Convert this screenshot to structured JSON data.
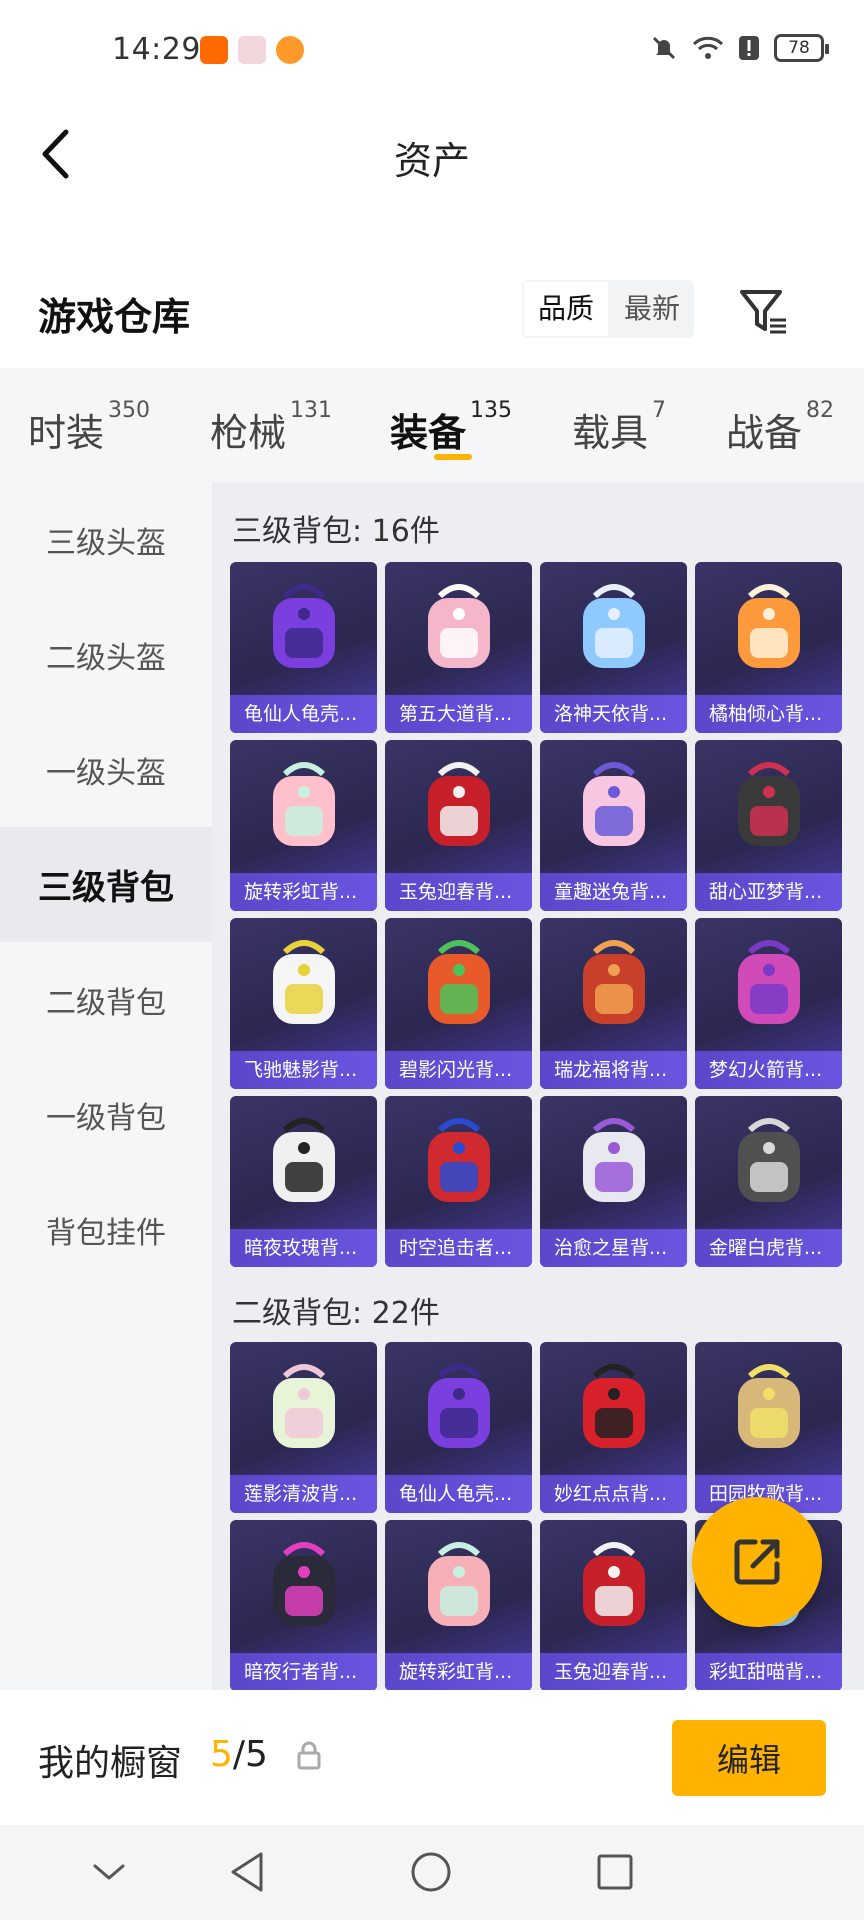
{
  "status_bar": {
    "time": "14:29",
    "battery": "78",
    "icons": [
      "taobao-app-icon",
      "app-icon-2",
      "app-icon-3",
      "mute-icon",
      "wifi-icon",
      "alert-icon"
    ]
  },
  "header": {
    "title": "资产"
  },
  "warehouse": {
    "title": "游戏仓库",
    "sort_options": [
      "品质",
      "最新"
    ],
    "active_sort": "品质"
  },
  "tabs": [
    {
      "label": "时装",
      "count": "350"
    },
    {
      "label": "枪械",
      "count": "131"
    },
    {
      "label": "装备",
      "count": "135"
    },
    {
      "label": "载具",
      "count": "7"
    },
    {
      "label": "战备",
      "count": "82"
    }
  ],
  "active_tab": "装备",
  "sidebar": {
    "items": [
      "三级头盔",
      "二级头盔",
      "一级头盔",
      "三级背包",
      "二级背包",
      "一级背包",
      "背包挂件"
    ],
    "active": "三级背包"
  },
  "sections": [
    {
      "title": "三级背包: 16件",
      "items": [
        {
          "name": "龟仙人龟壳...",
          "colors": [
            "#7b3fe0",
            "#3d2a8a"
          ]
        },
        {
          "name": "第五大道背...",
          "colors": [
            "#f4b6c8",
            "#ffffff"
          ]
        },
        {
          "name": "洛神天依背...",
          "colors": [
            "#8ec9ff",
            "#e8f0ff"
          ]
        },
        {
          "name": "橘柚倾心背...",
          "colors": [
            "#ff9a3c",
            "#fff1d6"
          ]
        },
        {
          "name": "旋转彩虹背...",
          "colors": [
            "#ffc0cb",
            "#c7f0e0"
          ]
        },
        {
          "name": "玉兔迎春背...",
          "colors": [
            "#c8202a",
            "#f2f2f2"
          ]
        },
        {
          "name": "童趣迷兔背...",
          "colors": [
            "#f8c6e0",
            "#6a5ad8"
          ]
        },
        {
          "name": "甜心亚梦背...",
          "colors": [
            "#3a3a3a",
            "#d03050"
          ]
        },
        {
          "name": "飞驰魅影背...",
          "colors": [
            "#f5f5f5",
            "#e8d23a"
          ]
        },
        {
          "name": "碧影闪光背...",
          "colors": [
            "#e85a2a",
            "#4ec25a"
          ]
        },
        {
          "name": "瑞龙福将背...",
          "colors": [
            "#c8402a",
            "#f0a050"
          ]
        },
        {
          "name": "梦幻火箭背...",
          "colors": [
            "#d04ab8",
            "#7a3ac8"
          ]
        },
        {
          "name": "暗夜玫瑰背...",
          "colors": [
            "#f0f0f0",
            "#222222"
          ]
        },
        {
          "name": "时空追击者...",
          "colors": [
            "#d02a30",
            "#2a4ad0"
          ]
        },
        {
          "name": "治愈之星背...",
          "colors": [
            "#e8e8f0",
            "#9a5ad8"
          ]
        },
        {
          "name": "金曜白虎背...",
          "colors": [
            "#505050",
            "#d8d8d8"
          ]
        }
      ]
    },
    {
      "title": "二级背包: 22件",
      "items": [
        {
          "name": "莲影清波背...",
          "colors": [
            "#e8f4d8",
            "#f0c8d8"
          ]
        },
        {
          "name": "龟仙人龟壳...",
          "colors": [
            "#7b3fe0",
            "#3d2a8a"
          ]
        },
        {
          "name": "妙红点点背...",
          "colors": [
            "#d8202a",
            "#222222"
          ]
        },
        {
          "name": "田园牧歌背...",
          "colors": [
            "#d8b878",
            "#f0e068"
          ]
        },
        {
          "name": "暗夜行者背...",
          "colors": [
            "#2a2a3a",
            "#e040c0"
          ]
        },
        {
          "name": "旋转彩虹背...",
          "colors": [
            "#f8b0b8",
            "#c8f0e0"
          ]
        },
        {
          "name": "玉兔迎春背...",
          "colors": [
            "#c8202a",
            "#f2f2f2"
          ]
        },
        {
          "name": "彩虹甜喵背...",
          "colors": [
            "#a8e0f8",
            "#f8c8e0"
          ]
        }
      ]
    }
  ],
  "showcase": {
    "label": "我的橱窗",
    "current": "5",
    "separator": "/",
    "total": "5",
    "edit_label": "编辑"
  },
  "theme": {
    "accent": "#ffb300",
    "card_label_bg": "#5a47c9"
  }
}
